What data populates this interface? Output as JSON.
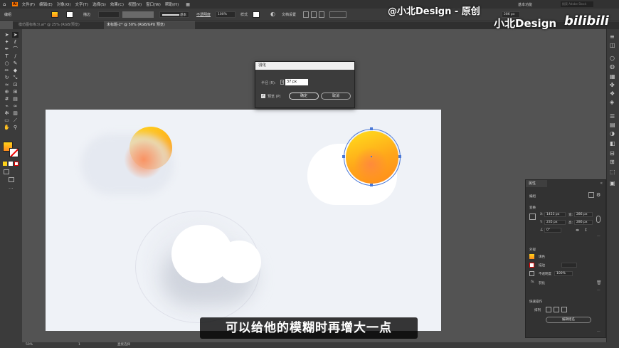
{
  "app": {
    "logo": "Ai"
  },
  "menu": {
    "items": [
      "文件(F)",
      "编辑(E)",
      "对象(O)",
      "文字(T)",
      "选择(S)",
      "效果(C)",
      "视图(V)",
      "窗口(W)",
      "帮助(H)"
    ],
    "workspace": "基本功能",
    "search_placeholder": "搜索 Adobe Stock"
  },
  "control_bar": {
    "selection_label": "编组",
    "stroke_label": "描边",
    "brush_label": "基本",
    "opacity_label": "不透明度",
    "opacity_value": "100%",
    "style_label": "样式",
    "doc_setup": "文档设置",
    "width_value": "286 px"
  },
  "tabs": [
    {
      "label": "模仿图标练习.ai* @ 25% (RGB/预览)",
      "active": false
    },
    {
      "label": "未标题-2* @ 50% (RGB/GPU 预览)",
      "active": true
    }
  ],
  "dialog": {
    "title": "羽化",
    "radius_label": "半径 (R):",
    "radius_value": "37 px",
    "preview_label": "预览 (P)",
    "ok_label": "确定",
    "cancel_label": "取消"
  },
  "properties_panel": {
    "title": "属性",
    "group_label": "编组",
    "transform_label": "变换",
    "x_label": "X:",
    "x_value": "1453 px",
    "y_label": "Y:",
    "y_value": "235 px",
    "w_label": "宽:",
    "w_value": "286 px",
    "h_label": "高:",
    "h_value": "286 px",
    "angle_value": "0°",
    "appearance_label": "外观",
    "fill_label": "填色",
    "stroke_label": "描边",
    "opacity_label": "不透明度",
    "opacity_value": "100%",
    "fx_label": "羽化",
    "quick_actions_label": "快速操作",
    "arrange_label": "排列",
    "edit_group_button": "编辑组名"
  },
  "status": {
    "zoom": "50%",
    "page": "1",
    "tool": "直接选择"
  },
  "overlay": {
    "subtitle": "可以给他的模糊时再增大一点",
    "watermark": "@小北Design - 原创",
    "brand": "小北Design",
    "brand2": "bilibili"
  },
  "colors": {
    "sun_top": "#ffd21a",
    "sun_bottom": "#ff8a1c",
    "artboard": "#eff2f7",
    "ui_dark": "#3b3b3b"
  }
}
